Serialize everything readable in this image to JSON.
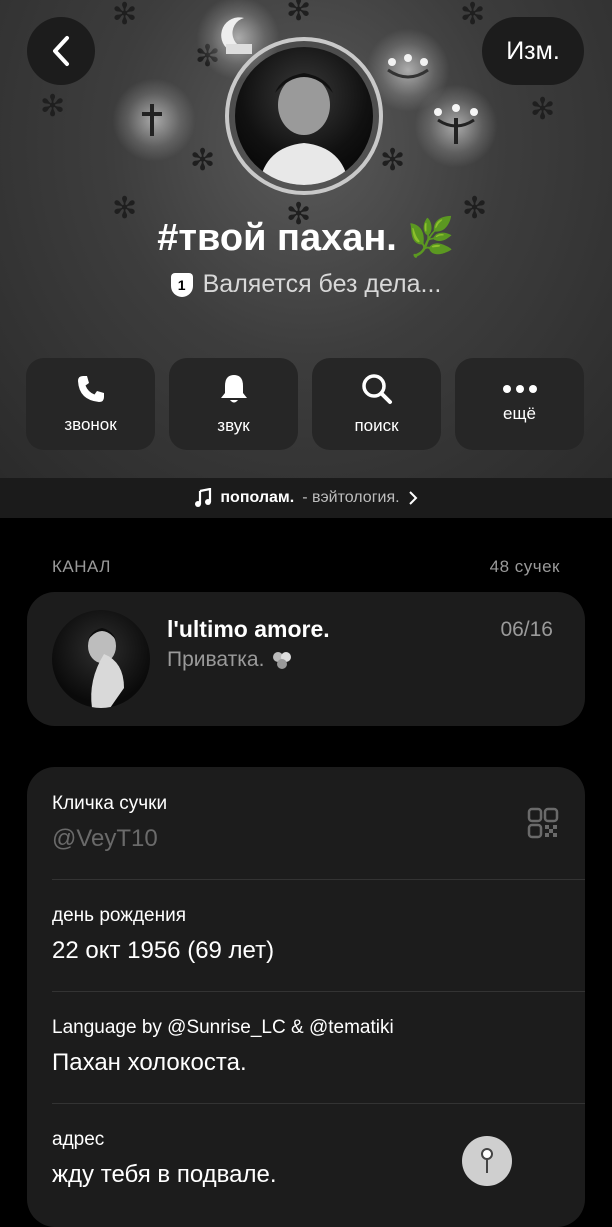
{
  "header": {
    "edit_label": "Изм.",
    "title": "#твой пахан. 🌿",
    "status_badge": "1",
    "status_text": "Валяется без дела..."
  },
  "actions": [
    {
      "label": "звонок",
      "icon": "phone-icon"
    },
    {
      "label": "звук",
      "icon": "bell-icon"
    },
    {
      "label": "поиск",
      "icon": "search-icon"
    },
    {
      "label": "ещё",
      "icon": "more-icon"
    }
  ],
  "music": {
    "title": "пополам.",
    "artist": "- вэйтология."
  },
  "channel_section": {
    "header": "КАНАЛ",
    "count": "48 сучек",
    "name": "l'ultimo amore.",
    "date": "06/16",
    "subtitle": "Приватка."
  },
  "info": {
    "username_label": "Кличка сучки",
    "username_value": "@VeyT10",
    "birthday_label": "день рождения",
    "birthday_value": "22 окт 1956 (69 лет)",
    "bio_label": "Language by @Sunrise_LC & @tematiki",
    "bio_value": "Пахан холокоста.",
    "address_label": "адрес",
    "address_value": "жду тебя в подвале."
  },
  "colors": {
    "background": "#000000",
    "card": "#1c1c1c",
    "action_button": "#262626",
    "secondary_text": "#9a9a9a"
  }
}
